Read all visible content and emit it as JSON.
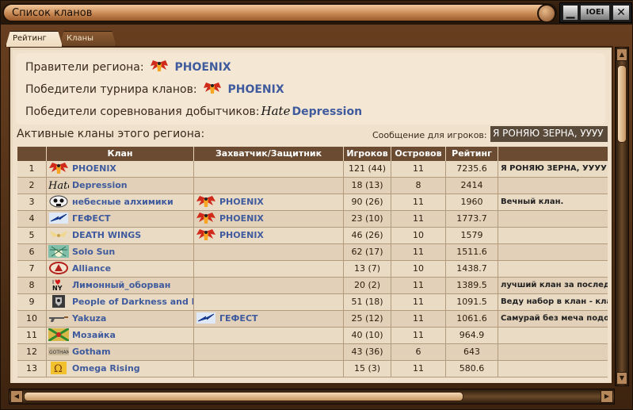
{
  "window": {
    "title": "Список кланов"
  },
  "tabs": [
    {
      "label": "Рейтинг"
    },
    {
      "label": "Кланы"
    }
  ],
  "info": {
    "rulers_label": "Правители региона:",
    "rulers_value": "PHOENIX",
    "tournament_label": "Победители турнира кланов:",
    "tournament_value": "PHOENIX",
    "miners_label": "Победители соревнования добытчиков:",
    "miners_emblem": "Hate",
    "miners_value": "Depression"
  },
  "active_title": "Активные кланы этого региона:",
  "message": {
    "label": "Сообщение для игроков:",
    "value": "Я РОНЯЮ ЗЕРНА, УУУУ"
  },
  "table": {
    "headers": [
      "",
      "Клан",
      "Захватчик/Защитник",
      "Игроков",
      "Островов",
      "Рейтинг",
      ""
    ],
    "rows": [
      {
        "num": "1",
        "clan": "PHOENIX",
        "emblem": "phoenix-emblem",
        "capturer": "",
        "players": "121 (44)",
        "islands": "11",
        "rating": "7235.6",
        "message": "Я РОНЯЮ ЗЕРНА, УУУУ"
      },
      {
        "num": "2",
        "clan": "Depression",
        "emblem": "hate-emblem",
        "capturer": "",
        "players": "18 (13)",
        "islands": "8",
        "rating": "2414",
        "message": ""
      },
      {
        "num": "3",
        "clan": "небесные алхимики",
        "emblem": "skull-emblem",
        "capturer": "PHOENIX",
        "players": "90 (26)",
        "islands": "11",
        "rating": "1960",
        "message": "Вечный клан."
      },
      {
        "num": "4",
        "clan": "ГЕФЕСТ",
        "emblem": "lightning-emblem",
        "capturer": "PHOENIX",
        "players": "23 (10)",
        "islands": "11",
        "rating": "1773.7",
        "message": ""
      },
      {
        "num": "5",
        "clan": "DEATH WINGS",
        "emblem": "wings-emblem",
        "capturer": "PHOENIX",
        "players": "46 (26)",
        "islands": "10",
        "rating": "1579",
        "message": ""
      },
      {
        "num": "6",
        "clan": "Solo Sun",
        "emblem": "sun-emblem",
        "capturer": "",
        "players": "62 (17)",
        "islands": "11",
        "rating": "1511.6",
        "message": ""
      },
      {
        "num": "7",
        "clan": "Alliance",
        "emblem": "alliance-emblem",
        "capturer": "",
        "players": "13 (7)",
        "islands": "10",
        "rating": "1438.7",
        "message": ""
      },
      {
        "num": "8",
        "clan": "Лимонный_оборван",
        "emblem": "iloveny-emblem",
        "capturer": "",
        "players": "20 (2)",
        "islands": "11",
        "rating": "1389.5",
        "message": "лучший клан за последн"
      },
      {
        "num": "9",
        "clan": "People of Darkness and D",
        "emblem": "crest-emblem",
        "capturer": "",
        "players": "51 (18)",
        "islands": "11",
        "rating": "1091.5",
        "message": "Веду набор в клан -  кла"
      },
      {
        "num": "10",
        "clan": "Yakuza",
        "emblem": "gun-emblem",
        "capturer": "ГЕФЕСТ",
        "players": "25 (12)",
        "islands": "11",
        "rating": "1061.6",
        "message": "Самурай без меча подо"
      },
      {
        "num": "11",
        "clan": "Мозайка",
        "emblem": "mosaic-emblem",
        "capturer": "",
        "players": "40 (10)",
        "islands": "11",
        "rating": "964.9",
        "message": ""
      },
      {
        "num": "12",
        "clan": "Gotham",
        "emblem": "gotham-emblem",
        "capturer": "",
        "players": "43 (36)",
        "islands": "6",
        "rating": "643",
        "message": ""
      },
      {
        "num": "13",
        "clan": "Omega Rising",
        "emblem": "omega-emblem",
        "capturer": "",
        "players": "15 (3)",
        "islands": "11",
        "rating": "580.6",
        "message": ""
      }
    ]
  },
  "emblem_texts": {
    "gotham": "GOTHAM",
    "hate": "Hate"
  },
  "controls": {
    "min": "▁",
    "logo": "IOEI",
    "close": "✕"
  }
}
